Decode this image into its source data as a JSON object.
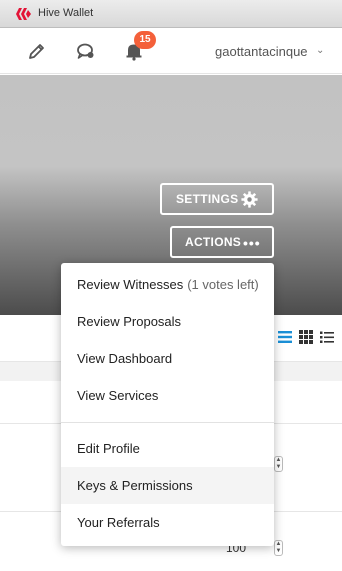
{
  "window": {
    "title": "Hive Wallet"
  },
  "header": {
    "notification_count": "15",
    "username": "gaottantacinque",
    "icons": [
      "pencil-icon",
      "chat-icon",
      "bell-icon",
      "chevron-down-icon"
    ]
  },
  "banner": {
    "settings_label": "SETTINGS",
    "actions_label": "ACTIONS"
  },
  "menu": {
    "items": [
      {
        "label": "Review Witnesses",
        "suffix": "(1 votes left)"
      },
      {
        "label": "Review Proposals"
      },
      {
        "label": "View Dashboard"
      },
      {
        "label": "View Services"
      },
      {
        "label": "Edit Profile"
      },
      {
        "label": "Keys & Permissions"
      },
      {
        "label": "Your Referrals"
      }
    ]
  },
  "content": {
    "view_icons": [
      "list-view-icon",
      "grid-view-icon",
      "compact-list-icon"
    ],
    "stepper_value": "100"
  },
  "colors": {
    "brand": "#e31337",
    "badge": "#f4603a",
    "active_view": "#1a8fd6"
  }
}
